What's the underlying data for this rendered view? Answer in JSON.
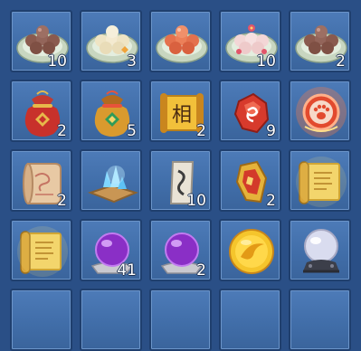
{
  "rows": [
    [
      {
        "icon": "plate-of-brown-dumplings-icon",
        "count": "10"
      },
      {
        "icon": "plate-of-white-dumplings-icon",
        "count": "3"
      },
      {
        "icon": "plate-of-orange-dumplings-icon",
        "count": ""
      },
      {
        "icon": "plate-of-pink-dumplings-icon",
        "count": "10"
      },
      {
        "icon": "plate-of-brown-dumplings-icon",
        "count": "2"
      }
    ],
    [
      {
        "icon": "red-lucky-bag-icon",
        "count": "2"
      },
      {
        "icon": "gold-lucky-bag-icon",
        "count": "5"
      },
      {
        "icon": "character-scroll-icon",
        "count": "2",
        "glyph": "相"
      },
      {
        "icon": "red-rune-stone-icon",
        "count": "9"
      },
      {
        "icon": "glowing-paw-medallion-icon",
        "count": ""
      }
    ],
    [
      {
        "icon": "parchment-scroll-icon",
        "count": "2"
      },
      {
        "icon": "blue-crystal-shards-icon",
        "count": ""
      },
      {
        "icon": "paper-talisman-icon",
        "count": "10"
      },
      {
        "icon": "red-gold-talisman-icon",
        "count": "2"
      },
      {
        "icon": "golden-scroll-icon",
        "count": ""
      }
    ],
    [
      {
        "icon": "golden-scroll-icon",
        "count": ""
      },
      {
        "icon": "purple-orb-icon",
        "count": "41"
      },
      {
        "icon": "purple-orb-icon",
        "count": "2"
      },
      {
        "icon": "golden-sun-orb-icon",
        "count": ""
      },
      {
        "icon": "crystal-ball-icon",
        "count": ""
      }
    ]
  ]
}
